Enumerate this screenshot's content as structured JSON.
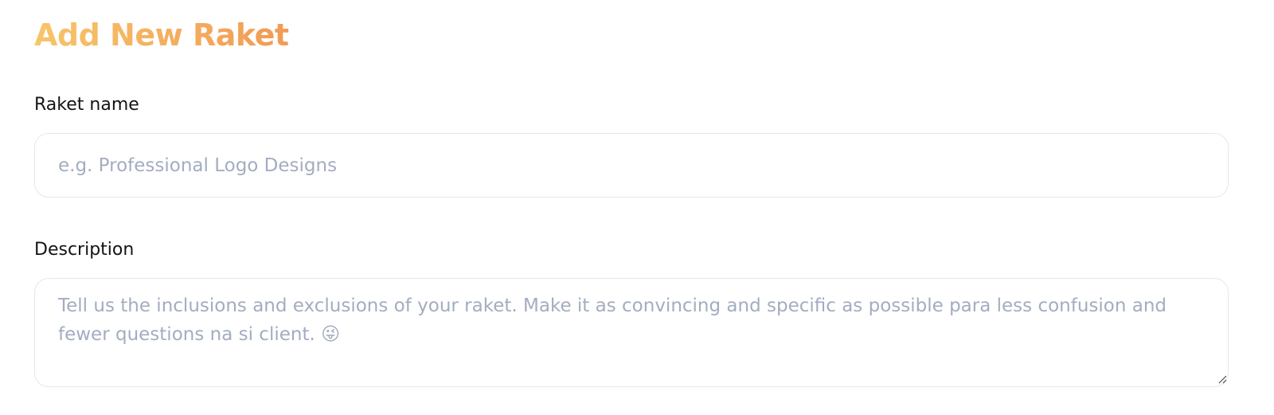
{
  "form": {
    "title": "Add New Raket",
    "name_field": {
      "label": "Raket name",
      "value": "",
      "placeholder": "e.g. Professional Logo Designs"
    },
    "description_field": {
      "label": "Description",
      "value": "",
      "placeholder": "Tell us the inclusions and exclusions of your raket. Make it as convincing and specific as possible para less confusion and fewer questions na si client. 😜"
    }
  },
  "colors": {
    "title_gradient_start": "#f7c56a",
    "title_gradient_end": "#f29a55",
    "label": "#141414",
    "placeholder": "#a3adc0",
    "field_border": "#e4e7ec"
  }
}
